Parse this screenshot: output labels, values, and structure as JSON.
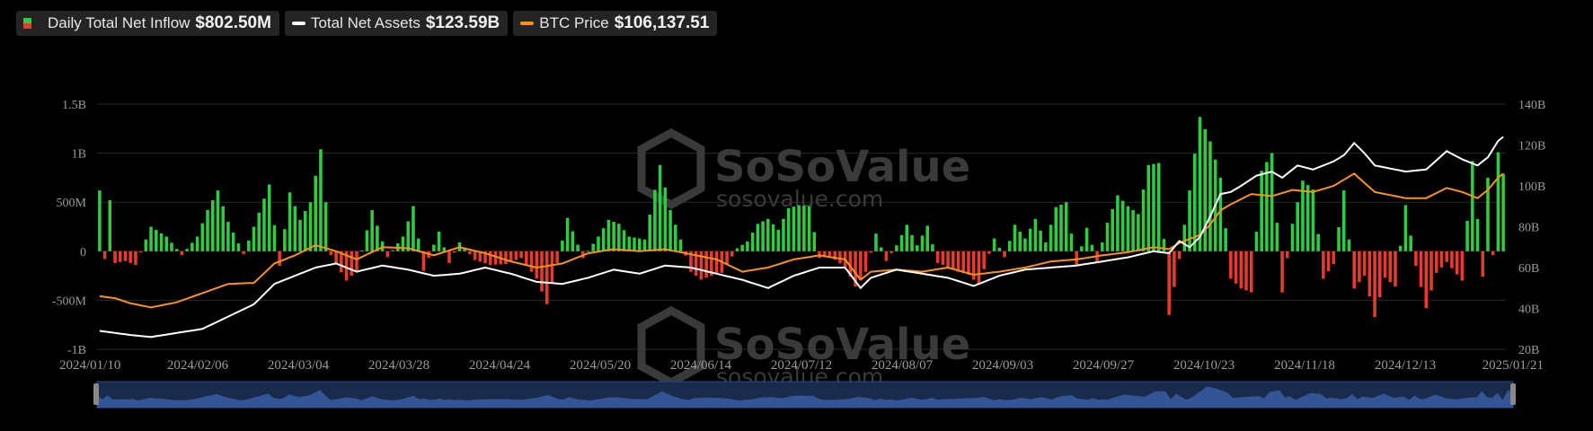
{
  "legend": [
    {
      "label": "Daily Total Net Inflow",
      "value": "$802.50M",
      "color_up": "#2ecc40",
      "color_down": "#e63b2e"
    },
    {
      "label": "Total Net Assets",
      "value": "$123.59B",
      "color": "#ffffff"
    },
    {
      "label": "BTC Price",
      "value": "$106,137.51",
      "color": "#f7931a"
    }
  ],
  "watermark": {
    "brand": "SoSoValue",
    "url": "sosovalue.com"
  },
  "chart_data": {
    "type": "bar",
    "grid": true,
    "legend_position": "top-left",
    "x_ticks": [
      "2024/01/10",
      "2024/02/06",
      "2024/03/04",
      "2024/03/28",
      "2024/04/24",
      "2024/05/20",
      "2024/06/14",
      "2024/07/12",
      "2024/08/07",
      "2024/09/03",
      "2024/09/27",
      "2024/10/23",
      "2024/11/18",
      "2024/12/13",
      "2025/01/21"
    ],
    "y_left": {
      "ticks": [
        "1.5B",
        "1B",
        "500M",
        "0",
        "-500M",
        "-1B"
      ],
      "values": [
        1500,
        1000,
        500,
        0,
        -500,
        -1000
      ],
      "unit": "M USD",
      "ylim": [
        -1000,
        1500
      ]
    },
    "y_right": {
      "ticks": [
        "140B",
        "120B",
        "100B",
        "80B",
        "60B",
        "40B",
        "20B"
      ],
      "values": [
        140,
        120,
        100,
        80,
        60,
        40,
        20
      ],
      "unit": "B USD",
      "ylim": [
        20,
        140
      ]
    },
    "series": [
      {
        "name": "Daily Total Net Inflow",
        "type": "bar",
        "axis": "left",
        "key_points": [
          [
            0,
            620
          ],
          [
            1,
            -80
          ],
          [
            2,
            520
          ],
          [
            3,
            -120
          ],
          [
            5,
            -100
          ],
          [
            7,
            -140
          ],
          [
            10,
            250
          ],
          [
            13,
            150
          ],
          [
            16,
            -40
          ],
          [
            19,
            150
          ],
          [
            21,
            420
          ],
          [
            23,
            620
          ],
          [
            25,
            300
          ],
          [
            28,
            -30
          ],
          [
            30,
            250
          ],
          [
            33,
            680
          ],
          [
            35,
            -150
          ],
          [
            37,
            600
          ],
          [
            39,
            320
          ],
          [
            41,
            500
          ],
          [
            43,
            1040
          ],
          [
            45,
            -40
          ],
          [
            48,
            -300
          ],
          [
            50,
            -200
          ],
          [
            53,
            420
          ],
          [
            56,
            -60
          ],
          [
            59,
            150
          ],
          [
            61,
            460
          ],
          [
            63,
            -200
          ],
          [
            66,
            200
          ],
          [
            68,
            -120
          ],
          [
            70,
            90
          ],
          [
            73,
            -90
          ],
          [
            76,
            -140
          ],
          [
            79,
            -130
          ],
          [
            82,
            -70
          ],
          [
            85,
            -280
          ],
          [
            87,
            -540
          ],
          [
            89,
            -120
          ],
          [
            91,
            340
          ],
          [
            94,
            -70
          ],
          [
            97,
            150
          ],
          [
            99,
            320
          ],
          [
            101,
            280
          ],
          [
            103,
            150
          ],
          [
            106,
            120
          ],
          [
            109,
            880
          ],
          [
            111,
            420
          ],
          [
            113,
            120
          ],
          [
            115,
            -210
          ],
          [
            117,
            -290
          ],
          [
            119,
            -250
          ],
          [
            121,
            -220
          ],
          [
            124,
            30
          ],
          [
            126,
            100
          ],
          [
            128,
            280
          ],
          [
            130,
            330
          ],
          [
            132,
            220
          ],
          [
            134,
            440
          ],
          [
            136,
            470
          ],
          [
            138,
            460
          ],
          [
            140,
            -70
          ],
          [
            142,
            -50
          ],
          [
            145,
            -160
          ],
          [
            147,
            -360
          ],
          [
            149,
            -210
          ],
          [
            151,
            180
          ],
          [
            153,
            -100
          ],
          [
            155,
            60
          ],
          [
            157,
            270
          ],
          [
            159,
            60
          ],
          [
            161,
            260
          ],
          [
            163,
            -120
          ],
          [
            165,
            -160
          ],
          [
            167,
            -210
          ],
          [
            169,
            -240
          ],
          [
            171,
            -340
          ],
          [
            174,
            130
          ],
          [
            176,
            -60
          ],
          [
            178,
            270
          ],
          [
            180,
            130
          ],
          [
            182,
            330
          ],
          [
            184,
            90
          ],
          [
            186,
            450
          ],
          [
            188,
            500
          ],
          [
            190,
            -140
          ],
          [
            192,
            240
          ],
          [
            194,
            -110
          ],
          [
            196,
            290
          ],
          [
            198,
            570
          ],
          [
            200,
            460
          ],
          [
            202,
            380
          ],
          [
            204,
            880
          ],
          [
            206,
            900
          ],
          [
            208,
            -650
          ],
          [
            210,
            -80
          ],
          [
            212,
            620
          ],
          [
            214,
            1370
          ],
          [
            216,
            1120
          ],
          [
            218,
            750
          ],
          [
            220,
            -280
          ],
          [
            222,
            -380
          ],
          [
            224,
            -420
          ],
          [
            226,
            820
          ],
          [
            228,
            1000
          ],
          [
            230,
            -420
          ],
          [
            232,
            280
          ],
          [
            234,
            720
          ],
          [
            236,
            630
          ],
          [
            238,
            -280
          ],
          [
            240,
            -130
          ],
          [
            242,
            620
          ],
          [
            244,
            -380
          ],
          [
            246,
            -250
          ],
          [
            248,
            -670
          ],
          [
            250,
            -270
          ],
          [
            252,
            -360
          ],
          [
            254,
            470
          ],
          [
            256,
            -150
          ],
          [
            258,
            -580
          ],
          [
            260,
            -220
          ],
          [
            262,
            -110
          ],
          [
            265,
            -300
          ],
          [
            267,
            920
          ],
          [
            269,
            -260
          ],
          [
            270,
            750
          ],
          [
            271,
            -40
          ],
          [
            272,
            1010
          ],
          [
            273,
            790
          ]
        ]
      },
      {
        "name": "Total Net Assets",
        "type": "line",
        "axis": "right",
        "key_points": [
          [
            0,
            29
          ],
          [
            3,
            28
          ],
          [
            6,
            27
          ],
          [
            10,
            26
          ],
          [
            15,
            28
          ],
          [
            20,
            30
          ],
          [
            25,
            36
          ],
          [
            30,
            42
          ],
          [
            34,
            52
          ],
          [
            38,
            56
          ],
          [
            42,
            60
          ],
          [
            46,
            62
          ],
          [
            50,
            58
          ],
          [
            55,
            61
          ],
          [
            60,
            59
          ],
          [
            65,
            56
          ],
          [
            70,
            57
          ],
          [
            75,
            60
          ],
          [
            80,
            57
          ],
          [
            85,
            53
          ],
          [
            90,
            52
          ],
          [
            95,
            55
          ],
          [
            100,
            59
          ],
          [
            105,
            57
          ],
          [
            110,
            61
          ],
          [
            115,
            60
          ],
          [
            120,
            57
          ],
          [
            125,
            54
          ],
          [
            130,
            50
          ],
          [
            135,
            56
          ],
          [
            140,
            60
          ],
          [
            145,
            60
          ],
          [
            148,
            50
          ],
          [
            150,
            55
          ],
          [
            155,
            59
          ],
          [
            160,
            57
          ],
          [
            165,
            55
          ],
          [
            170,
            51
          ],
          [
            175,
            56
          ],
          [
            180,
            59
          ],
          [
            185,
            60
          ],
          [
            190,
            61
          ],
          [
            195,
            63
          ],
          [
            200,
            65
          ],
          [
            205,
            68
          ],
          [
            208,
            67
          ],
          [
            210,
            73
          ],
          [
            212,
            70
          ],
          [
            214,
            75
          ],
          [
            216,
            85
          ],
          [
            218,
            96
          ],
          [
            220,
            97
          ],
          [
            222,
            100
          ],
          [
            225,
            105
          ],
          [
            228,
            107
          ],
          [
            230,
            104
          ],
          [
            233,
            110
          ],
          [
            236,
            108
          ],
          [
            240,
            112
          ],
          [
            242,
            115
          ],
          [
            244,
            121
          ],
          [
            246,
            116
          ],
          [
            248,
            110
          ],
          [
            250,
            109
          ],
          [
            254,
            107
          ],
          [
            258,
            108
          ],
          [
            262,
            117
          ],
          [
            265,
            113
          ],
          [
            268,
            110
          ],
          [
            270,
            114
          ],
          [
            271,
            118
          ],
          [
            272,
            122
          ],
          [
            273,
            124
          ]
        ]
      },
      {
        "name": "BTC Price",
        "type": "line",
        "axis": "right",
        "key_points": [
          [
            0,
            46000
          ],
          [
            3,
            45000
          ],
          [
            6,
            42500
          ],
          [
            10,
            40500
          ],
          [
            15,
            43000
          ],
          [
            20,
            47500
          ],
          [
            25,
            52000
          ],
          [
            30,
            52500
          ],
          [
            34,
            62000
          ],
          [
            38,
            66000
          ],
          [
            42,
            71000
          ],
          [
            46,
            68000
          ],
          [
            50,
            64000
          ],
          [
            55,
            70000
          ],
          [
            60,
            69500
          ],
          [
            65,
            66000
          ],
          [
            70,
            70000
          ],
          [
            75,
            67000
          ],
          [
            80,
            63000
          ],
          [
            85,
            60000
          ],
          [
            90,
            62000
          ],
          [
            95,
            67000
          ],
          [
            100,
            69000
          ],
          [
            105,
            68000
          ],
          [
            110,
            69000
          ],
          [
            115,
            66500
          ],
          [
            120,
            64000
          ],
          [
            125,
            58000
          ],
          [
            130,
            60000
          ],
          [
            135,
            64000
          ],
          [
            140,
            66000
          ],
          [
            145,
            64000
          ],
          [
            148,
            54000
          ],
          [
            150,
            58000
          ],
          [
            155,
            59000
          ],
          [
            160,
            58000
          ],
          [
            165,
            60000
          ],
          [
            170,
            56500
          ],
          [
            175,
            58000
          ],
          [
            180,
            60000
          ],
          [
            185,
            63000
          ],
          [
            190,
            64000
          ],
          [
            195,
            66000
          ],
          [
            200,
            67500
          ],
          [
            205,
            70000
          ],
          [
            208,
            69000
          ],
          [
            210,
            72000
          ],
          [
            214,
            76000
          ],
          [
            216,
            81000
          ],
          [
            218,
            88000
          ],
          [
            220,
            91000
          ],
          [
            224,
            96000
          ],
          [
            228,
            95000
          ],
          [
            232,
            98000
          ],
          [
            236,
            97000
          ],
          [
            240,
            100000
          ],
          [
            244,
            106000
          ],
          [
            248,
            97000
          ],
          [
            250,
            96000
          ],
          [
            254,
            94000
          ],
          [
            258,
            94000
          ],
          [
            262,
            99000
          ],
          [
            265,
            97000
          ],
          [
            268,
            94000
          ],
          [
            270,
            98000
          ],
          [
            272,
            104000
          ],
          [
            273,
            106000
          ]
        ]
      }
    ]
  }
}
